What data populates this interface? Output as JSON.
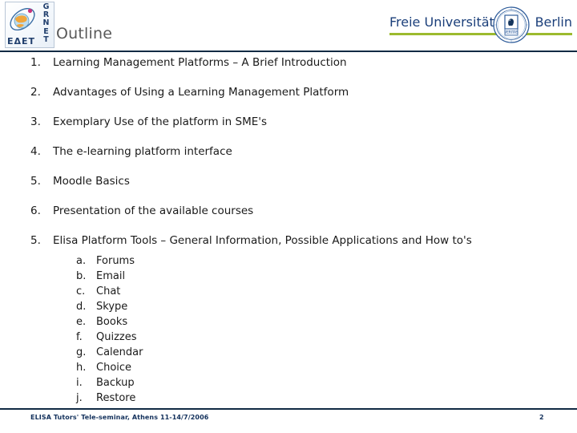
{
  "header": {
    "title": "Outline",
    "logo_grnet": {
      "name_latin": "GRNET",
      "name_greek": "ΕΔΕΤ"
    },
    "partner_logo": {
      "text_left": "Freie Universität",
      "text_right": "Berlin",
      "seal_name": "fu-berlin-seal",
      "rule_color": "#9cba2e"
    },
    "rule_color": "#102a43"
  },
  "outline": {
    "items": [
      {
        "marker": "1.",
        "text": "Learning Management Platforms – A Brief Introduction"
      },
      {
        "marker": "2.",
        "text": "Advantages of Using a Learning Management Platform"
      },
      {
        "marker": "3.",
        "text": "Exemplary Use of the platform in SME's"
      },
      {
        "marker": "4.",
        "text": "The e-learning platform interface"
      },
      {
        "marker": "5.",
        "text": "Moodle Basics"
      },
      {
        "marker": "6.",
        "text": "Presentation of the available courses"
      },
      {
        "marker": "5.",
        "text": "Elisa Platform Tools – General Information, Possible Applications and How to's"
      }
    ],
    "sub_items": [
      {
        "marker": "a.",
        "text": "Forums"
      },
      {
        "marker": "b.",
        "text": "Email"
      },
      {
        "marker": "c.",
        "text": "Chat"
      },
      {
        "marker": "d.",
        "text": "Skype"
      },
      {
        "marker": "e.",
        "text": "Books"
      },
      {
        "marker": "f.",
        "text": "Quizzes"
      },
      {
        "marker": "g.",
        "text": "Calendar"
      },
      {
        "marker": "h.",
        "text": "Choice"
      },
      {
        "marker": "i.",
        "text": "Backup"
      },
      {
        "marker": "j.",
        "text": "Restore"
      }
    ]
  },
  "footer": {
    "text": "ELISA Tutors' Tele-seminar, Athens 11-14/7/2006",
    "page_number": "2",
    "rule_color": "#102a43"
  }
}
